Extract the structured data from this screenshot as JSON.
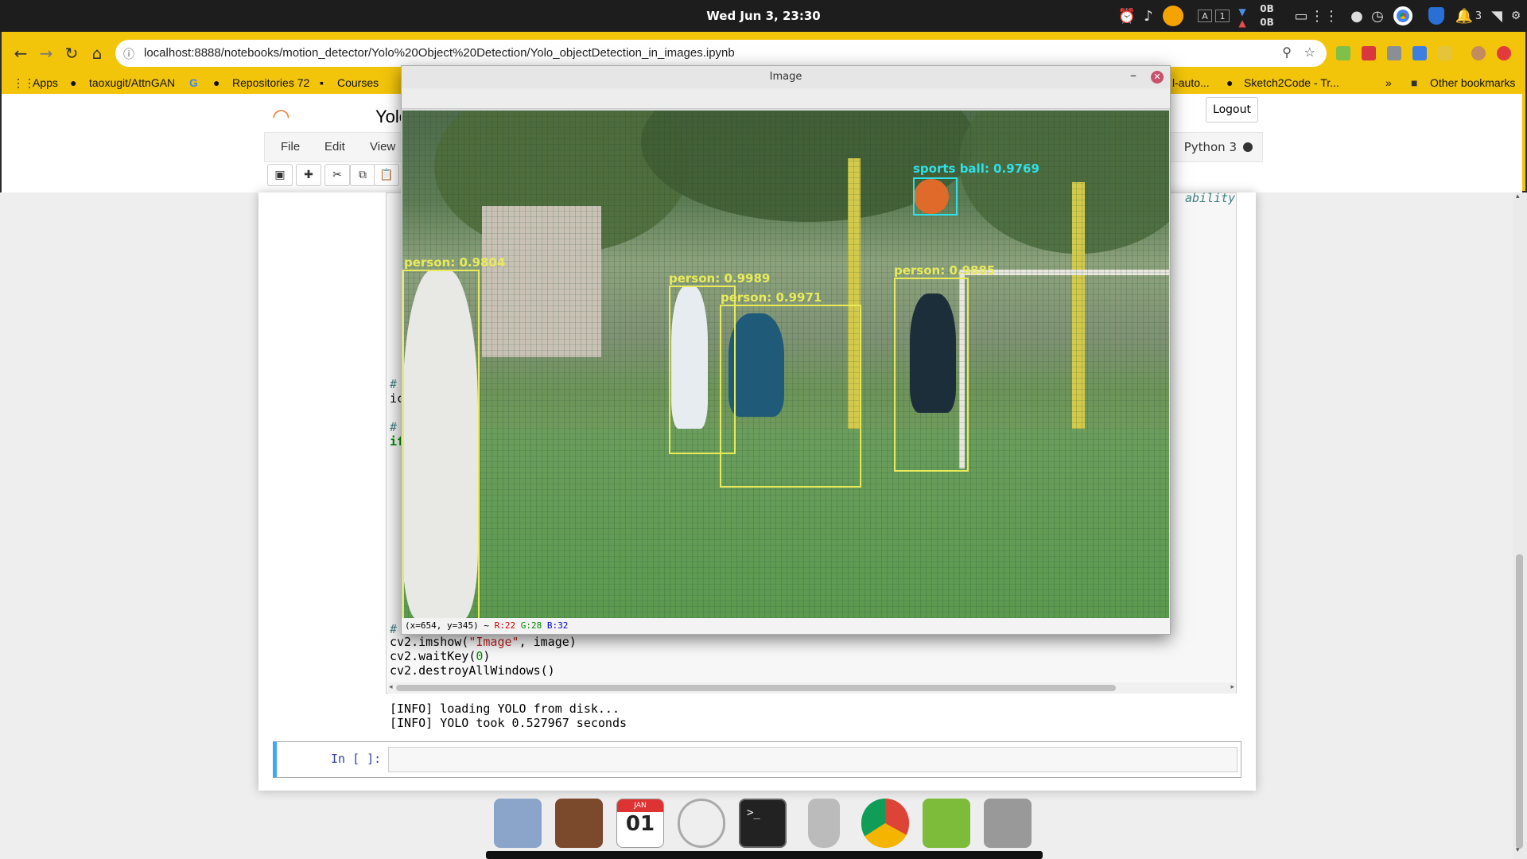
{
  "system": {
    "clock": "Wed Jun 3, 23:30",
    "net_down": "0B",
    "net_up": "0B",
    "notif_count": "3"
  },
  "browser": {
    "url": "localhost:8888/notebooks/motion_detector/Yolo%20Object%20Detection/Yolo_objectDetection_in_images.ipynb",
    "bookmarks": [
      "Apps",
      "taoxugit/AttnGAN",
      "Repositories 72",
      "Courses",
      "l-auto...",
      "Sketch2Code - Tr...",
      "Other bookmarks"
    ],
    "more": "»"
  },
  "jupyter": {
    "logo": "jupyter",
    "notebook_name": "Yolo",
    "logout": "Logout",
    "menus": [
      "File",
      "Edit",
      "View"
    ],
    "kernel": "Python 3"
  },
  "code": {
    "trailing": "ability",
    "frag1": "#",
    "frag2": "ic",
    "frag3": "#",
    "frag4": "if",
    "comment_line": "#",
    "line_imshow_a": "cv2.imshow(",
    "line_imshow_str": "\"Image\"",
    "line_imshow_b": ", image)",
    "line_wait_a": "cv2.waitKey(",
    "line_wait_num": "0",
    "line_wait_b": ")",
    "line_destroy": "cv2.destroyAllWindows()"
  },
  "output": [
    "[INFO] loading YOLO from disk...",
    "[INFO] YOLO took 0.527967 seconds"
  ],
  "next_cell": {
    "prompt": "In [ ]:"
  },
  "image_window": {
    "title": "Image",
    "status": {
      "coords": "(x=654, y=345) ~",
      "r": "R:22",
      "g": "G:28",
      "b": "B:32"
    },
    "detections": [
      "person: 0.9804",
      "person: 0.9989",
      "person: 0.9971",
      "person: 0.9885",
      "sports ball: 0.9769"
    ]
  },
  "dock": [
    "mail-app-icon",
    "speaker-app-icon",
    "calendar-icon",
    "clock-icon",
    "terminal-icon",
    "trash-icon",
    "chrome-icon",
    "files-icon",
    "settings-icon"
  ],
  "dock_calendar": {
    "month": "JAN",
    "day": "01"
  },
  "colors": {
    "browser_bar": "#f2c40a",
    "detection_box": "#e9ea5a",
    "ball_box": "#30e0e8",
    "jupyter_orange": "#f37626"
  }
}
